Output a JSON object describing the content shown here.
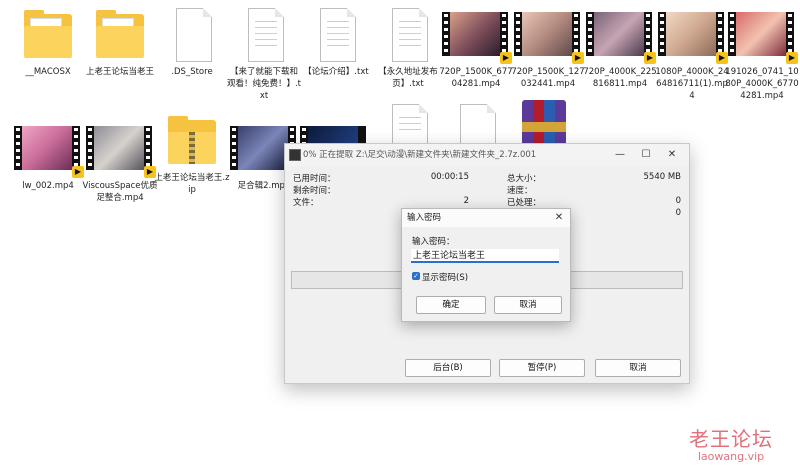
{
  "files": [
    {
      "name": "__MACOSX",
      "type": "folder"
    },
    {
      "name": "上老王论坛当老王",
      "type": "folder"
    },
    {
      "name": ".DS_Store",
      "type": "file"
    },
    {
      "name": "【来了就能下载和观看！纯免费！】.txt",
      "type": "txt"
    },
    {
      "name": "【论坛介绍】.txt",
      "type": "txt"
    },
    {
      "name": "【永久地址发布页】.txt",
      "type": "txt"
    },
    {
      "name": "720P_1500K_67704281.mp4",
      "type": "video"
    },
    {
      "name": "720P_1500K_127032441.mp4",
      "type": "video"
    },
    {
      "name": "720P_4000K_225816811.mp4",
      "type": "video"
    },
    {
      "name": "1080P_4000K_2464816711(1).mp4",
      "type": "video"
    },
    {
      "name": "191026_0741_1080P_4000K_67704281.mp4",
      "type": "video"
    },
    {
      "name": "lw_002.mp4",
      "type": "video"
    },
    {
      "name": "ViscousSpace优质足整合.mp4",
      "type": "video"
    },
    {
      "name": "上老王论坛当老王.zip",
      "type": "zip"
    },
    {
      "name": "足合辑2.mp4",
      "type": "video"
    },
    {
      "name": "",
      "type": "video"
    },
    {
      "name": "",
      "type": "txt"
    },
    {
      "name": "",
      "type": "file"
    },
    {
      "name": "",
      "type": "rar"
    }
  ],
  "extract_window": {
    "title": "0% 正在提取 Z:\\足交\\动漫\\新建文件夹\\新建文件夹_2.7z.001",
    "elapsed_label": "已用时间：",
    "elapsed_value": "00:00:15",
    "remaining_label": "剩余时间：",
    "files_label": "文件：",
    "files_value": "2",
    "total_size_label": "总大小：",
    "total_size_value": "5540 MB",
    "speed_label": "速度：",
    "processed_label": "已处理：",
    "processed_value": "0",
    "ratio_value": "0",
    "background_button": "后台(B)",
    "pause_button": "暂停(P)",
    "cancel_button": "取消",
    "progress_fraction": 0
  },
  "password_dialog": {
    "title": "输入密码",
    "prompt_label": "输入密码：",
    "password_value": "上老王论坛当老王",
    "show_password_label": "显示密码(S)",
    "show_password_checked": true,
    "ok_button": "确定",
    "cancel_button": "取消"
  },
  "watermark": {
    "title": "老王论坛",
    "url": "laowang.vip"
  },
  "colors": {
    "accent": "#2a6fd0",
    "folder": "#f5c340",
    "watermark": "#e46f7a"
  }
}
